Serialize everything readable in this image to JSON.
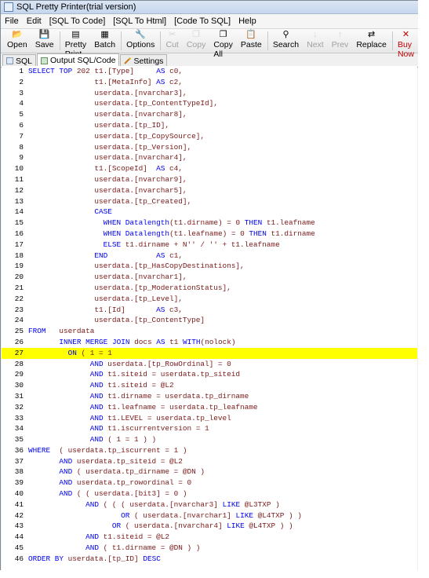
{
  "window": {
    "title": "SQL Pretty Printer(trial version)"
  },
  "menu": [
    "File",
    "Edit",
    "[SQL To Code]",
    "[SQL To Html]",
    "[Code To SQL]",
    "Help"
  ],
  "toolbar": [
    {
      "label": "Open",
      "icon": "folder-open-icon",
      "enabled": true
    },
    {
      "label": "Save",
      "icon": "floppy-icon",
      "enabled": true
    },
    {
      "sep": true
    },
    {
      "label": "Pretty Print",
      "icon": "pretty-print-icon",
      "enabled": true
    },
    {
      "label": "Batch",
      "icon": "batch-icon",
      "enabled": true
    },
    {
      "sep": true
    },
    {
      "label": "Options",
      "icon": "wrench-icon",
      "enabled": true
    },
    {
      "sep": true
    },
    {
      "label": "Cut",
      "icon": "scissors-icon",
      "enabled": false
    },
    {
      "label": "Copy",
      "icon": "copy-icon",
      "enabled": false
    },
    {
      "label": "Copy All",
      "icon": "copy-all-icon",
      "enabled": true
    },
    {
      "label": "Paste",
      "icon": "paste-icon",
      "enabled": true
    },
    {
      "sep": true
    },
    {
      "label": "Search",
      "icon": "binoculars-icon",
      "enabled": true
    },
    {
      "label": "Next",
      "icon": "next-icon",
      "enabled": false
    },
    {
      "label": "Prev",
      "icon": "prev-icon",
      "enabled": false
    },
    {
      "label": "Replace",
      "icon": "replace-icon",
      "enabled": true
    },
    {
      "sep": true
    },
    {
      "label": "Buy Now",
      "icon": "buy-now-icon",
      "enabled": true
    }
  ],
  "tabs": [
    {
      "label": "SQL",
      "icon": "sql-tab-icon",
      "active": false
    },
    {
      "label": "Output SQL/Code",
      "icon": "output-tab-icon",
      "active": true
    },
    {
      "label": "Settings",
      "icon": "settings-tab-icon",
      "active": false
    }
  ],
  "highlight_line": 27,
  "code_lines": [
    "SELECT TOP 202 t1.[Type]     AS c0,",
    "               t1.[MetaInfo] AS c2,",
    "               userdata.[nvarchar3],",
    "               userdata.[tp_ContentTypeId],",
    "               userdata.[nvarchar8],",
    "               userdata.[tp_ID],",
    "               userdata.[tp_CopySource],",
    "               userdata.[tp_Version],",
    "               userdata.[nvarchar4],",
    "               t1.[ScopeId]  AS c4,",
    "               userdata.[nvarchar9],",
    "               userdata.[nvarchar5],",
    "               userdata.[tp_Created],",
    "               CASE",
    "                 WHEN Datalength(t1.dirname) = 0 THEN t1.leafname",
    "                 WHEN Datalength(t1.leafname) = 0 THEN t1.dirname",
    "                 ELSE t1.dirname + N'' / '' + t1.leafname",
    "               END           AS c1,",
    "               userdata.[tp_HasCopyDestinations],",
    "               userdata.[nvarchar1],",
    "               userdata.[tp_ModerationStatus],",
    "               userdata.[tp_Level],",
    "               t1.[Id]       AS c3,",
    "               userdata.[tp_ContentType]",
    "FROM   userdata",
    "       INNER MERGE JOIN docs AS t1 WITH(nolock)",
    "         ON ( 1 = 1",
    "              AND userdata.[tp_RowOrdinal] = 0",
    "              AND t1.siteid = userdata.tp_siteid",
    "              AND t1.siteid = @L2",
    "              AND t1.dirname = userdata.tp_dirname",
    "              AND t1.leafname = userdata.tp_leafname",
    "              AND t1.LEVEL = userdata.tp_level",
    "              AND t1.iscurrentversion = 1",
    "              AND ( 1 = 1 ) )",
    "WHERE  ( userdata.tp_iscurrent = 1 )",
    "       AND userdata.tp_siteid = @L2",
    "       AND ( userdata.tp_dirname = @DN )",
    "       AND userdata.tp_rowordinal = 0",
    "       AND ( ( userdata.[bit3] = 0 )",
    "             AND ( ( ( userdata.[nvarchar3] LIKE @L3TXP )",
    "                     OR ( userdata.[nvarchar1] LIKE @L4TXP ) )",
    "                   OR ( userdata.[nvarchar4] LIKE @L4TXP ) )",
    "             AND t1.siteid = @L2",
    "             AND ( t1.dirname = @DN ) )",
    "ORDER BY userdata.[tp_ID] DESC"
  ]
}
